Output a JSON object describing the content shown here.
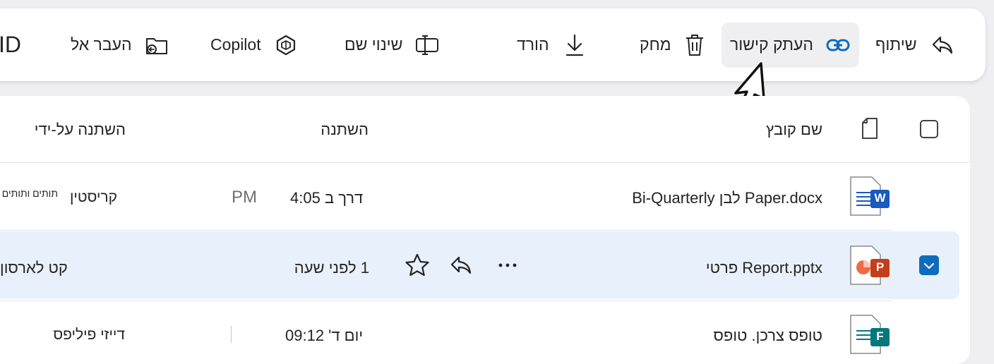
{
  "toolbar": {
    "share_label": "שיתוף",
    "copy_link_label": "העתק קישור",
    "delete_label": "מחק",
    "download_label": "הורד",
    "rename_label": "שינוי שם",
    "copilot_label": "Copilot",
    "move_label": "העבר אל",
    "overflow_label": "ID"
  },
  "table": {
    "headers": {
      "name": "שם קובץ",
      "modified": "השתנה",
      "modified_by": "השתנה על-ידי"
    },
    "rows": [
      {
        "name": "Bi-Quarterly לבן Paper.docx",
        "modified": "דרך ב 4:05",
        "modified_suffix": "PM",
        "modified_by": "קריסטין",
        "modified_by_small": "תותים ותותים",
        "file_type": "word",
        "file_badge": "W",
        "selected": false
      },
      {
        "name": "פרטי Report.pptx",
        "modified": "לפני שעה",
        "modified_prefix": "1",
        "modified_by": "קט לארסון",
        "file_type": "powerpoint",
        "file_badge": "P",
        "selected": true
      },
      {
        "name": "טופס צרכן. טופס",
        "modified": "יום ד' 09:12",
        "modified_by": "דייזי פיליפס",
        "file_type": "forms",
        "file_badge": "F",
        "selected": false
      }
    ]
  },
  "colors": {
    "word": "#185abd",
    "powerpoint": "#c43e1c",
    "forms": "#03787c",
    "accent": "#0f6cbd",
    "selected_row": "#e8f0fb"
  }
}
